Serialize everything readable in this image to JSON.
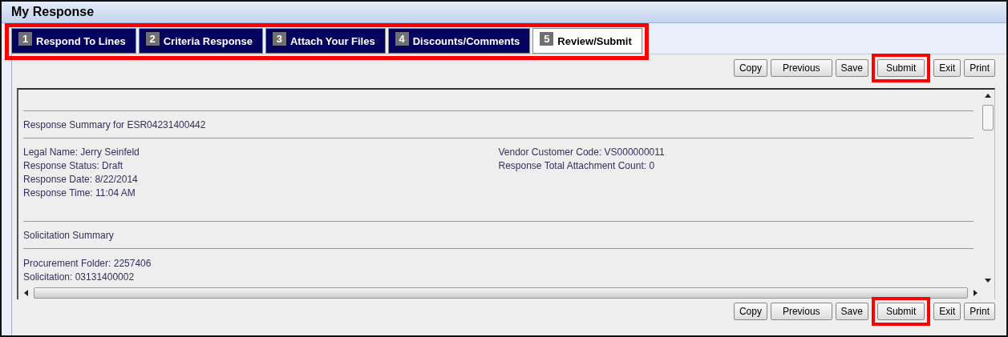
{
  "window": {
    "title": "My Response"
  },
  "tabs_highlighted": true,
  "tabs": [
    {
      "number": "1",
      "label": "Respond To Lines",
      "selected": false
    },
    {
      "number": "2",
      "label": "Criteria Response",
      "selected": false
    },
    {
      "number": "3",
      "label": "Attach Your Files",
      "selected": false
    },
    {
      "number": "4",
      "label": "Discounts/Comments",
      "selected": false
    },
    {
      "number": "5",
      "label": "Review/Submit",
      "selected": true
    }
  ],
  "top_buttons": [
    {
      "label": "Copy",
      "highlighted": false
    },
    {
      "label": "Previous",
      "highlighted": false
    },
    {
      "label": "Save",
      "highlighted": false
    },
    {
      "label": "Submit",
      "highlighted": true
    },
    {
      "label": "Exit",
      "highlighted": false
    },
    {
      "label": "Print",
      "highlighted": false
    }
  ],
  "summary": {
    "heading": "Response Summary for ESR04231400442",
    "left": [
      "Legal Name: Jerry Seinfeld",
      "Response Status: Draft",
      "Response Date: 8/22/2014",
      "Response Time: 11:04 AM"
    ],
    "right": [
      "Vendor Customer Code: VS000000011",
      "Response Total Attachment Count: 0"
    ]
  },
  "solicitation": {
    "heading": "Solicitation Summary",
    "lines": [
      "Procurement Folder: 2257406",
      "Solicitation: 03131400002"
    ]
  },
  "bottom_buttons": [
    {
      "label": "Copy",
      "highlighted": false
    },
    {
      "label": "Previous",
      "highlighted": false
    },
    {
      "label": "Save",
      "highlighted": false
    },
    {
      "label": "Submit",
      "highlighted": true
    },
    {
      "label": "Exit",
      "highlighted": false
    },
    {
      "label": "Print",
      "highlighted": false
    }
  ]
}
